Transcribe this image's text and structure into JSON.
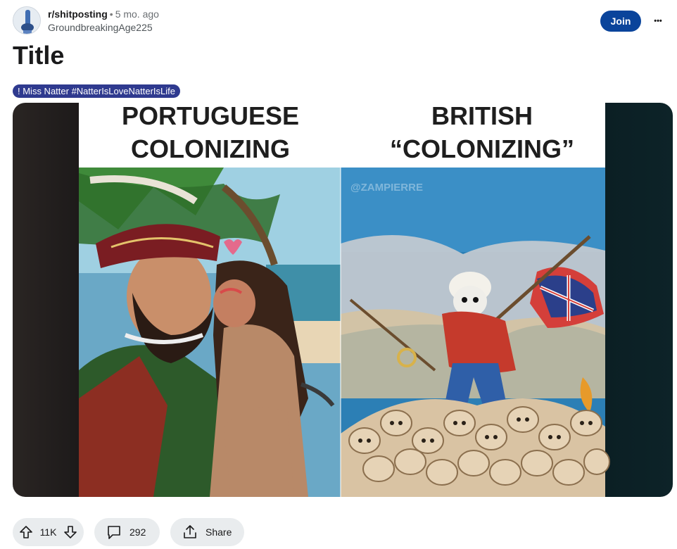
{
  "post": {
    "subreddit": "r/shitposting",
    "separator": "•",
    "age": "5 mo. ago",
    "author": "GroundbreakingAge225",
    "join_label": "Join",
    "more_label": "•••",
    "title": "Title",
    "flair": "! Miss Natter #NatterIsLoveNatterIsLife"
  },
  "media": {
    "left_caption_line1": "PORTUGUESE",
    "left_caption_line2": "COLONIZING",
    "right_caption_line1": "BRITISH",
    "right_caption_line2": "“COLONIZING”",
    "watermark": "@ZAMPIERRE"
  },
  "actions": {
    "upvotes": "11K",
    "comments": "292",
    "share_label": "Share"
  },
  "icons": {
    "upvote": "arrow-up-icon",
    "downvote": "arrow-down-icon",
    "comment": "comment-bubble-icon",
    "share": "share-icon",
    "more": "ellipsis-icon"
  },
  "colors": {
    "join_button": "#0a449b",
    "flair_background": "#2f3a8f",
    "pill_background": "#e9ecee"
  }
}
